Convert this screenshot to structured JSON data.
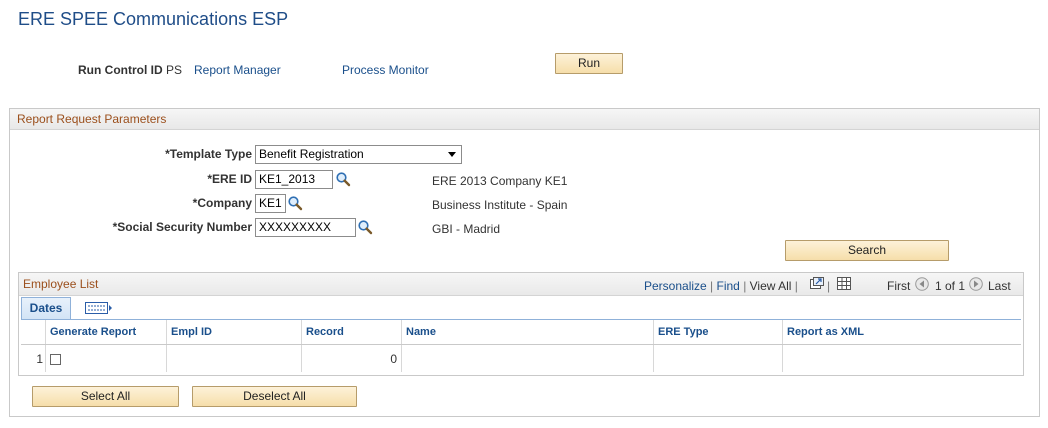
{
  "page": {
    "title": "ERE SPEE Communications ESP"
  },
  "run_control": {
    "label": "Run Control ID",
    "value": "PS",
    "report_manager": "Report Manager",
    "process_monitor": "Process Monitor",
    "run_label": "Run"
  },
  "params": {
    "title": "Report Request Parameters",
    "template_type_label": "*Template Type",
    "template_type_value": "Benefit Registration",
    "ere_id_label": "*ERE ID",
    "ere_id_value": "KE1_2013",
    "ere_id_desc": "ERE 2013 Company KE1",
    "company_label": "*Company",
    "company_value": "KE1",
    "company_desc": "Business Institute - Spain",
    "ssn_label": "*Social Security Number",
    "ssn_value": "XXXXXXXXX",
    "ssn_desc": "GBI - Madrid",
    "search_label": "Search"
  },
  "employee_list": {
    "title": "Employee List",
    "nav": {
      "personalize": "Personalize",
      "find": "Find",
      "view_all": "View All",
      "first": "First",
      "range": "1 of 1",
      "last": "Last"
    },
    "tab_dates": "Dates",
    "columns": [
      "Generate Report",
      "Empl ID",
      "Record",
      "Name",
      "ERE Type",
      "Report as XML"
    ],
    "rows": [
      {
        "num": "1",
        "empl_id": "",
        "record": "0",
        "name": "",
        "ere_type": "",
        "report_xml": ""
      }
    ]
  },
  "actions": {
    "select_all": "Select All",
    "deselect_all": "Deselect All"
  },
  "colors": {
    "title": "#1f4d88",
    "link": "#1a4f8b",
    "group_title": "#9b4f1c",
    "button_fill": "#f6deaa"
  }
}
